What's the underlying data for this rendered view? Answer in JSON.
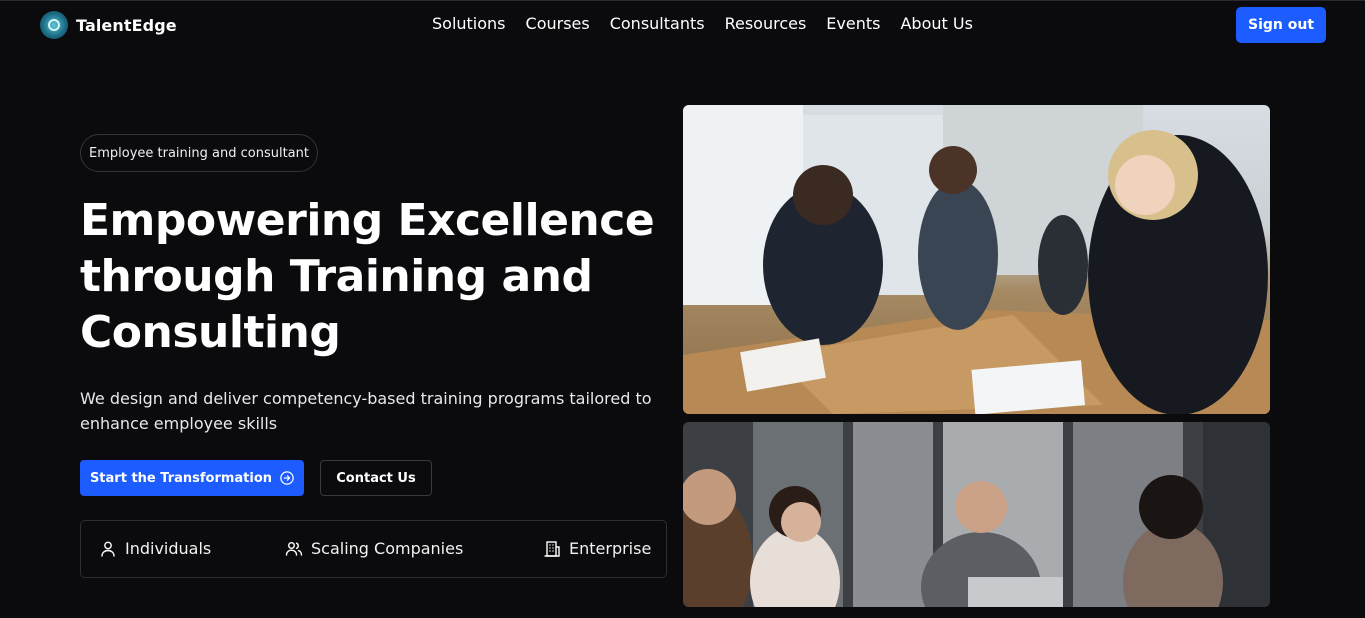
{
  "header": {
    "brand": "TalentEdge",
    "nav": [
      "Solutions",
      "Courses",
      "Consultants",
      "Resources",
      "Events",
      "About Us"
    ],
    "sign_out": "Sign out"
  },
  "hero": {
    "badge": "Employee training and consultant",
    "headline_lines": [
      "Empowering Excellence",
      "through Training and",
      "Consulting"
    ],
    "subtitle": "We design and deliver competency-based training programs tailored to enhance employee skills",
    "primary_cta": "Start the Transformation",
    "secondary_cta": "Contact Us",
    "segments": [
      {
        "label": "Individuals",
        "icon": "user-icon"
      },
      {
        "label": "Scaling Companies",
        "icon": "users-icon"
      },
      {
        "label": "Enterprise",
        "icon": "building-icon"
      }
    ]
  },
  "images": [
    {
      "icon": "team-meeting-photo"
    },
    {
      "icon": "office-discussion-photo"
    }
  ],
  "colors": {
    "background": "#0b0a0d",
    "accent": "#1d5cff",
    "text": "#ffffff"
  }
}
